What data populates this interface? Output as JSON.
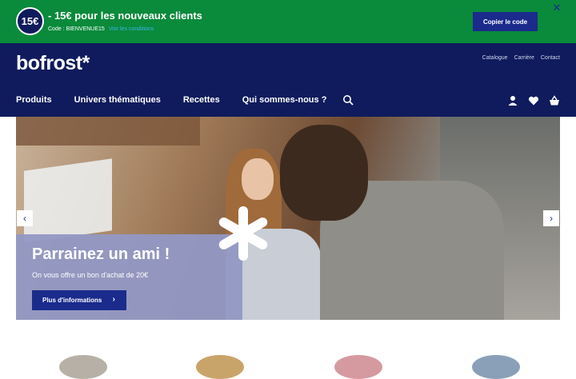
{
  "promo": {
    "badge": "15€",
    "headline": "- 15€ pour les nouveaux clients",
    "code_text": "Code : BIENVENUE15",
    "conditions_link": "Voir les conditions",
    "copy_button": "Copier le code",
    "close_icon": "close-icon"
  },
  "header": {
    "logo": "bofrost*",
    "top_links": [
      "Catalogue",
      "Carrière",
      "Contact"
    ],
    "nav": [
      "Produits",
      "Univers thématiques",
      "Recettes",
      "Qui sommes-nous ?"
    ],
    "icons": [
      "search-icon",
      "user-icon",
      "heart-icon",
      "basket-icon"
    ]
  },
  "hero": {
    "title": "Parrainez un ami !",
    "subtitle": "On vous offre un bon d'achat de 20€",
    "button": "Plus d'informations",
    "prev_arrow": "‹",
    "next_arrow": "›"
  },
  "colors": {
    "promo_bg": "#0a8a3b",
    "header_bg": "#0f1b5c",
    "accent_blue": "#1a2b8c",
    "panel_bg": "#9298c4"
  }
}
